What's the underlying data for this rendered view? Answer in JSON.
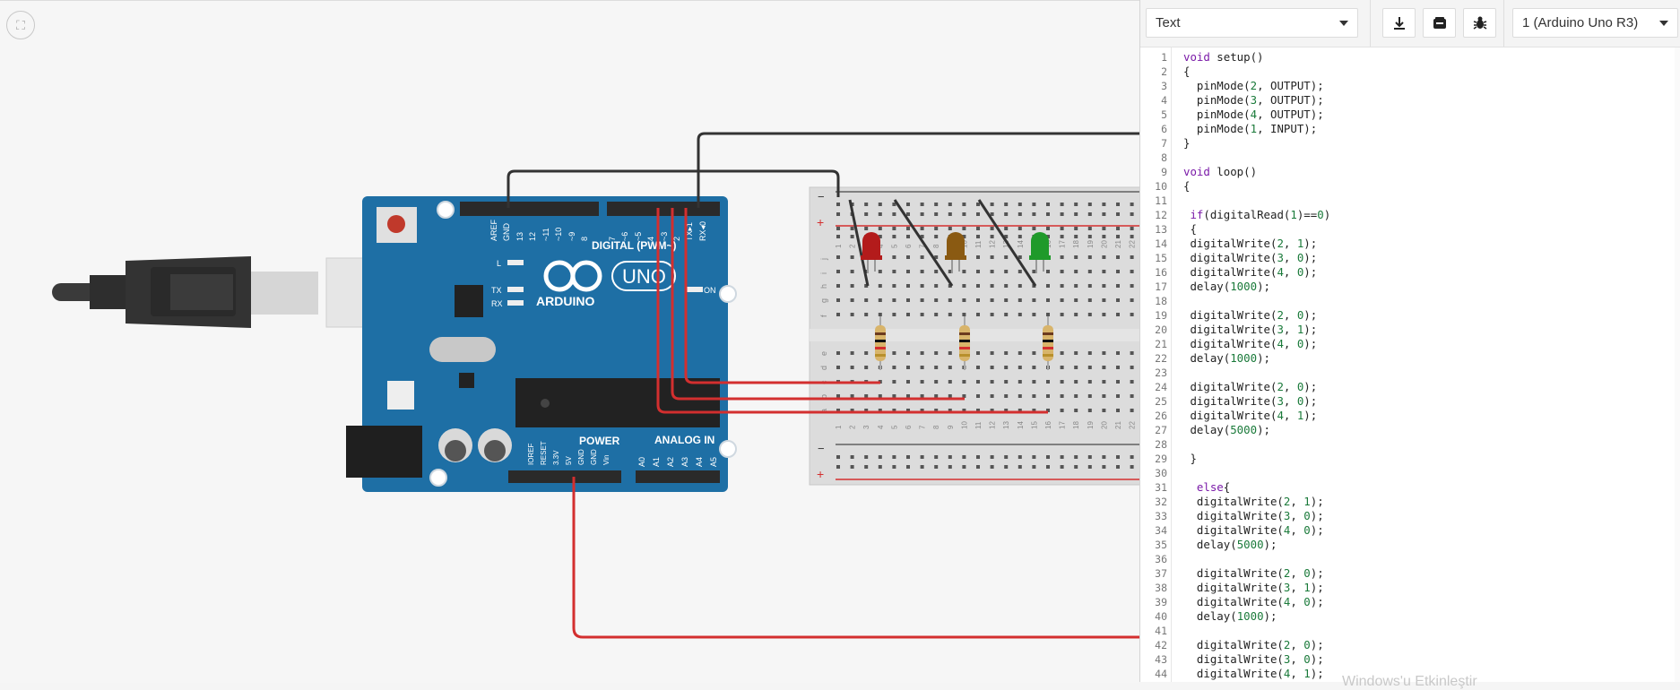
{
  "toolbar": {
    "mode_label": "Text",
    "device_label": "1 (Arduino Uno R3)",
    "download_icon": "download-icon",
    "libraries_icon": "libraries-icon",
    "debugger_icon": "bug-icon"
  },
  "circuit": {
    "fullscreen_icon": "fit-to-view-icon",
    "board_brand": "ARDUINO",
    "board_model": "UNO",
    "digital_label": "DIGITAL (PWM~)",
    "power_label": "POWER",
    "analog_label": "ANALOG IN",
    "on_label": "ON",
    "l_label": "L",
    "tx_label": "TX",
    "rx_label": "RX",
    "header_top_labels": [
      "AREF",
      "GND",
      "13",
      "12",
      "~11",
      "~10",
      "~9",
      "8",
      "7",
      "~6",
      "~5",
      "4",
      "~3",
      "2",
      "TX▸1",
      "RX◂0"
    ],
    "power_pin_labels": [
      "IOREF",
      "RESET",
      "3.3V",
      "5V",
      "GND",
      "GND",
      "Vin"
    ],
    "analog_pin_labels": [
      "A0",
      "A1",
      "A2",
      "A3",
      "A4",
      "A5"
    ],
    "breadboard_rows": [
      "j",
      "i",
      "h",
      "g",
      "f",
      "e",
      "d",
      "c",
      "b",
      "a"
    ],
    "breadboard_cols": [
      "1",
      "2",
      "3",
      "4",
      "5",
      "6",
      "7",
      "8",
      "9",
      "10",
      "11",
      "12",
      "13",
      "14",
      "15",
      "16",
      "17",
      "18",
      "19",
      "20",
      "21",
      "22"
    ],
    "rail_minus": "−",
    "rail_plus": "+",
    "leds": [
      {
        "color": "#b31b1b"
      },
      {
        "color": "#8a5a12"
      },
      {
        "color": "#1f9a2a"
      }
    ]
  },
  "code": {
    "lines": [
      "void setup()",
      "{",
      "  pinMode(2, OUTPUT);",
      "  pinMode(3, OUTPUT);",
      "  pinMode(4, OUTPUT);",
      "  pinMode(1, INPUT);",
      "}",
      "",
      "void loop()",
      "{",
      "",
      " if(digitalRead(1)==0)",
      " {",
      " digitalWrite(2, 1);",
      " digitalWrite(3, 0);",
      " digitalWrite(4, 0);",
      " delay(1000);",
      "",
      " digitalWrite(2, 0);",
      " digitalWrite(3, 1);",
      " digitalWrite(4, 0);",
      " delay(1000);",
      "",
      " digitalWrite(2, 0);",
      " digitalWrite(3, 0);",
      " digitalWrite(4, 1);",
      " delay(5000);",
      "",
      " }",
      "",
      "  else{",
      "  digitalWrite(2, 1);",
      "  digitalWrite(3, 0);",
      "  digitalWrite(4, 0);",
      "  delay(5000);",
      "",
      "  digitalWrite(2, 0);",
      "  digitalWrite(3, 1);",
      "  digitalWrite(4, 0);",
      "  delay(1000);",
      "",
      "  digitalWrite(2, 0);",
      "  digitalWrite(3, 0);",
      "  digitalWrite(4, 1);"
    ]
  },
  "watermark": "Windows'u Etkinleştir"
}
